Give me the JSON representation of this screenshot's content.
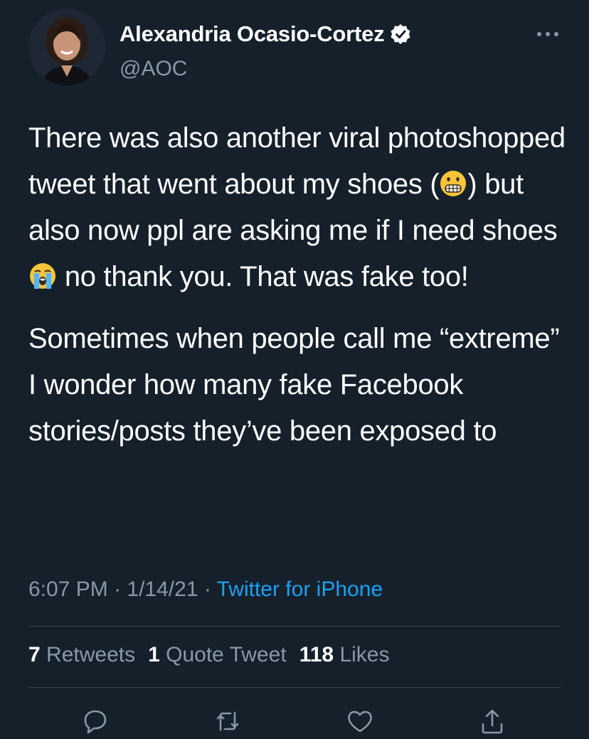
{
  "author": {
    "display_name": "Alexandria Ocasio-Cortez",
    "handle": "@AOC",
    "verified_icon": "verified-badge-icon"
  },
  "tweet": {
    "paragraph1_part1": "There was also another viral photoshopped tweet that went about my shoes (",
    "emoji1": "grimacing-face-emoji",
    "paragraph1_part2": ") but also now ppl are asking me if I need shoes ",
    "emoji2": "loudly-crying-face-emoji",
    "paragraph1_part3": " no thank you. That was fake too!",
    "paragraph2": "Sometimes when people call me “extreme” I wonder how many fake Facebook stories/posts they’ve been exposed to"
  },
  "meta": {
    "time": "6:07 PM",
    "separator1": " · ",
    "date": "1/14/21",
    "separator2": " · ",
    "source": "Twitter for iPhone"
  },
  "stats": {
    "retweets_count": "7",
    "retweets_label": "Retweets",
    "quotes_count": "1",
    "quotes_label": "Quote Tweet",
    "likes_count": "118",
    "likes_label": "Likes"
  },
  "actions": [
    "reply-icon",
    "retweet-icon",
    "like-icon",
    "share-icon"
  ],
  "colors": {
    "background": "#15202b",
    "text": "#ffffff",
    "secondary": "#8899a6",
    "link": "#1da1f2",
    "divider": "#38444d"
  }
}
